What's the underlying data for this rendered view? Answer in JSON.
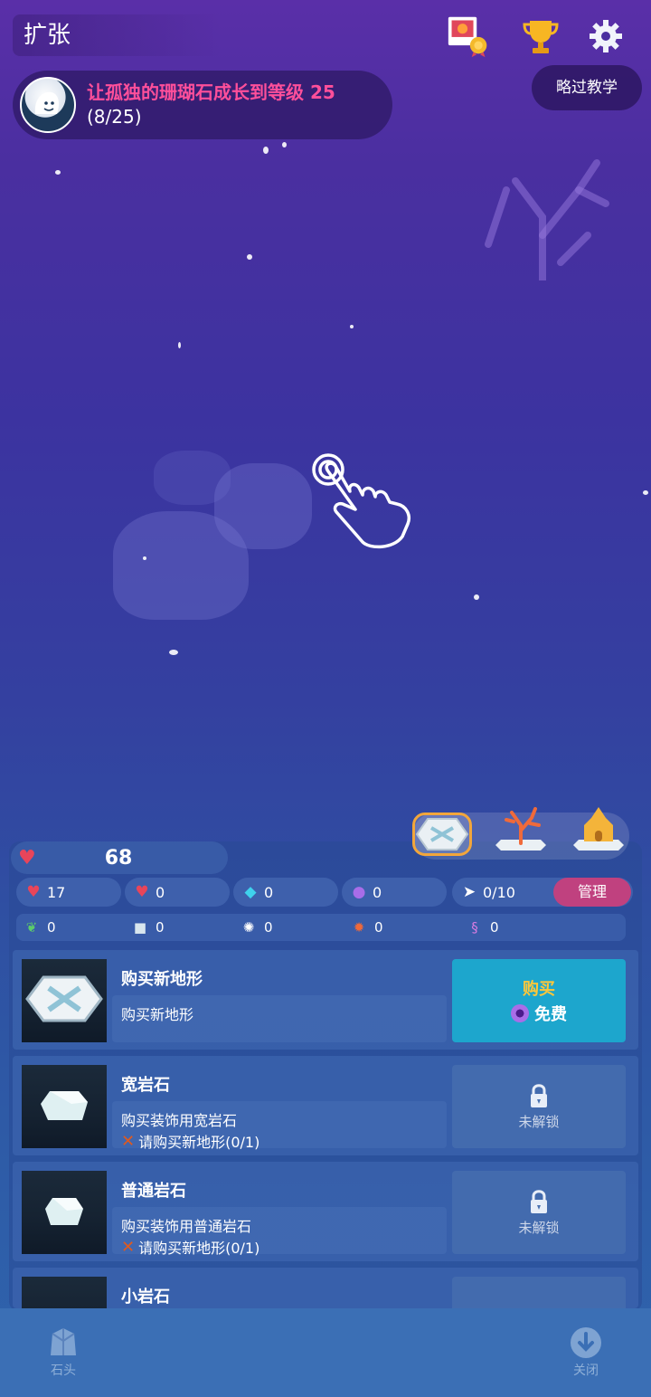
{
  "topbar": {
    "title": "扩张",
    "skip_tutorial": "略过教学"
  },
  "mission": {
    "text": "让孤独的珊瑚石成长到等级 25",
    "progress": "(8/25)"
  },
  "stats": {
    "hearts": "68",
    "tap_hearts": "17",
    "one_hearts": "0",
    "diamonds": "0",
    "pearls": "0",
    "fish": "0/10",
    "manage_label": "管理",
    "seaweed": "0",
    "stone_block": "0",
    "urchin": "0",
    "crab": "0",
    "seahorse": "0"
  },
  "items": [
    {
      "name": "购买新地形",
      "desc": "购买新地形",
      "req": "",
      "action": "buy",
      "buy_label": "购买",
      "price_label": "免费"
    },
    {
      "name": "宽岩石",
      "desc": "购买装饰用宽岩石",
      "req": "请购买新地形(0/1)",
      "action": "locked",
      "locked_label": "未解锁"
    },
    {
      "name": "普通岩石",
      "desc": "购买装饰用普通岩石",
      "req": "请购买新地形(0/1)",
      "action": "locked",
      "locked_label": "未解锁"
    },
    {
      "name": "小岩石"
    }
  ],
  "bottom_nav": {
    "left_label": "石头",
    "right_label": "关闭"
  },
  "colors": {
    "mission_text": "#ff4f9a",
    "buy_button": "#1da6cd",
    "buy_label": "#ffc73a",
    "manage_button": "#c0417f",
    "active_tab_border": "#f2a63b"
  }
}
